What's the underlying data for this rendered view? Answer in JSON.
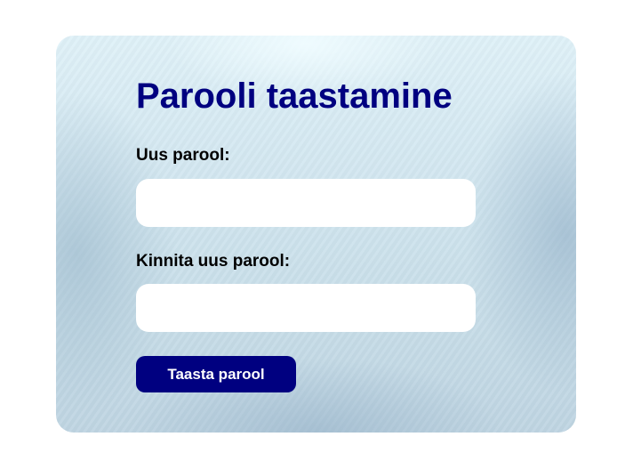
{
  "form": {
    "title": "Parooli taastamine",
    "new_password": {
      "label": "Uus parool:",
      "value": "",
      "placeholder": ""
    },
    "confirm_password": {
      "label": "Kinnita uus parool:",
      "value": "",
      "placeholder": ""
    },
    "submit_label": "Taasta parool"
  },
  "colors": {
    "accent": "#000080",
    "label_text": "#000000",
    "input_background": "#ffffff",
    "page_background": "#ffffff"
  }
}
